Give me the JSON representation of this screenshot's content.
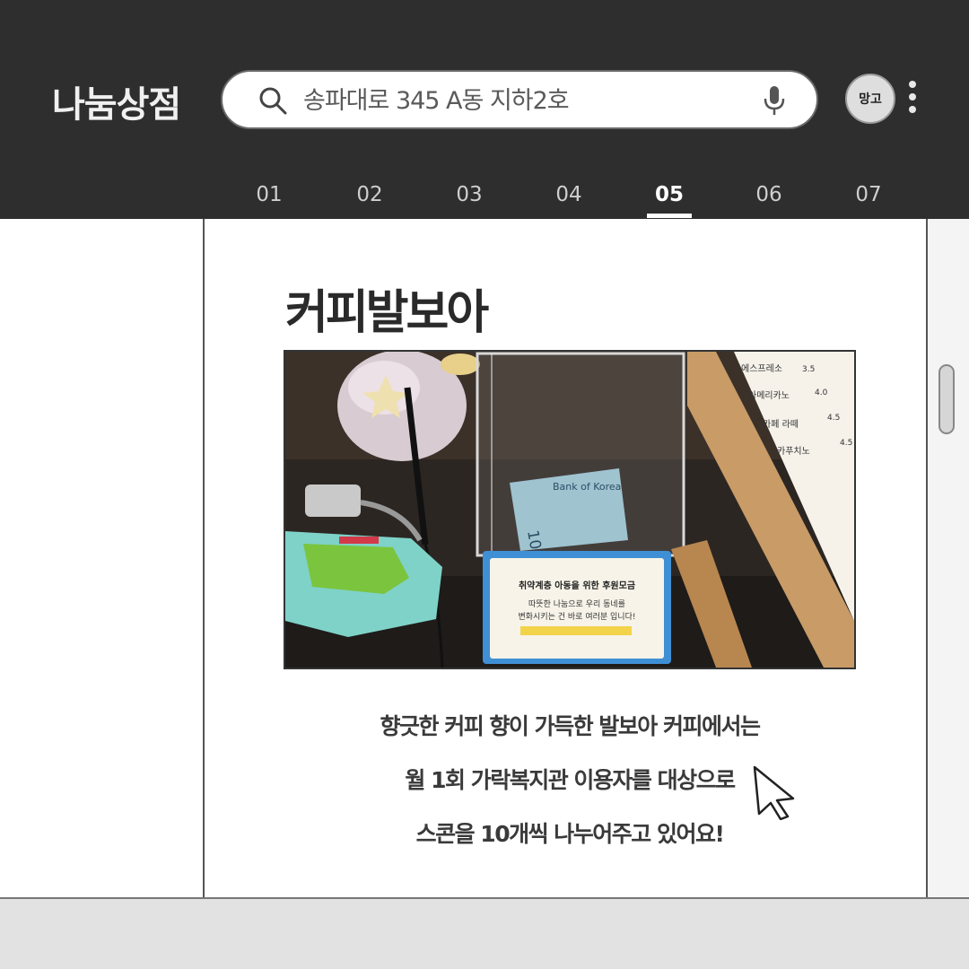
{
  "header": {
    "app_title": "나눔상점",
    "search": {
      "placeholder": "송파대로 345 A동 지하2호",
      "icon": "search-icon",
      "voice_icon": "mic-icon"
    },
    "avatar_label": "망고",
    "menu_icon": "kebab-icon"
  },
  "tabs": [
    {
      "label": "01"
    },
    {
      "label": "02"
    },
    {
      "label": "03"
    },
    {
      "label": "04"
    },
    {
      "label": "05",
      "active": true
    },
    {
      "label": "06"
    },
    {
      "label": "07"
    }
  ],
  "main": {
    "heading": "커피발보아",
    "photo": {
      "bill_text": "1000 won",
      "bank_text": "Bank of Korea",
      "menu_items": [
        "에스프레소",
        "아메리카노",
        "카페 라떼",
        "카푸치노"
      ],
      "menu_prices": [
        "3.5",
        "4.0",
        "4.5",
        "4.5"
      ],
      "card_lines": [
        "취약계층 아동을 위한 후원모금",
        "따뜻한 나눔으로 우리 동네를",
        "변화시키는 건 바로 여러분 입니다!"
      ]
    },
    "caption_lines": [
      "향긋한 커피 향이 가득한 발보아 커피에서는",
      "월 1회 가락복지관 이용자를 대상으로",
      "스콘을 10개씩 나누어주고 있어요!"
    ]
  },
  "colors": {
    "header_bg": "#2e2e2e",
    "accent": "#ffffff",
    "text": "#2a2a2a"
  }
}
